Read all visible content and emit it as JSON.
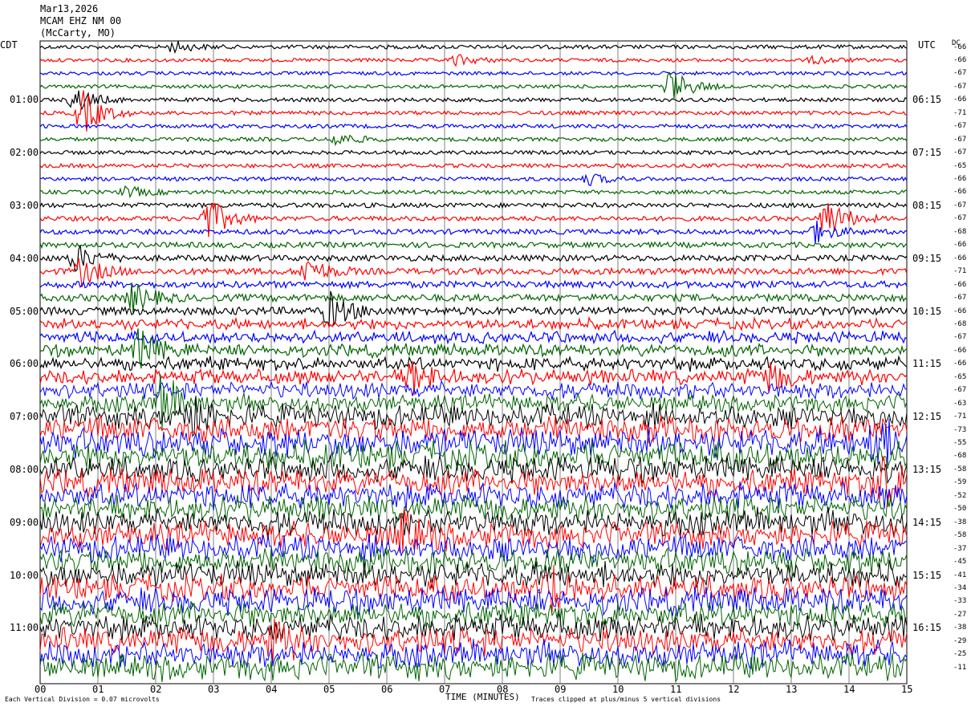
{
  "header": {
    "date": "Mar13,2026",
    "station": "MCAM EHZ NM 00",
    "location": "(McCarty, MO)"
  },
  "left_axis_label": "CDT",
  "right_axis_label": "UTC",
  "dc_label": "DC",
  "x_axis_title": "TIME (MINUTES)",
  "footer_left": "Each Vertical Division = 0.07 microvolts",
  "footer_right": "Traces clipped at plus/minus 5 vertical divisions",
  "colors": {
    "trace_cycle": [
      "#000000",
      "#ff0000",
      "#0000ff",
      "#006400"
    ],
    "grid": "#808080",
    "background": "#ffffff"
  },
  "chart_data": {
    "type": "line",
    "title": "MCAM EHZ NM 00 (McCarty, MO) Mar13,2026",
    "xlabel": "TIME (MINUTES)",
    "ylabel_left": "CDT",
    "ylabel_right": "UTC",
    "x_ticks": [
      "00",
      "01",
      "02",
      "03",
      "04",
      "05",
      "06",
      "07",
      "08",
      "09",
      "10",
      "11",
      "12",
      "13",
      "14",
      "15"
    ],
    "xlim": [
      0,
      15
    ],
    "trace_minutes": 15,
    "trace_count": 48,
    "left_time_labels": [
      "01:00",
      "02:00",
      "03:00",
      "04:00",
      "05:00",
      "06:00",
      "07:00",
      "08:00",
      "09:00",
      "10:00",
      "11:00"
    ],
    "right_time_labels": [
      "06:15",
      "07:15",
      "08:15",
      "09:15",
      "10:15",
      "11:15",
      "12:15",
      "13:15",
      "14:15",
      "15:15",
      "16:15"
    ],
    "hour_label_trace_index": [
      4,
      8,
      12,
      16,
      20,
      24,
      28,
      32,
      36,
      40,
      44
    ],
    "dc_offsets": [
      -66,
      -66,
      -67,
      -67,
      -66,
      -71,
      -67,
      -67,
      -67,
      -65,
      -66,
      -66,
      -67,
      -67,
      -68,
      -66,
      -66,
      -71,
      -66,
      -67,
      -66,
      -68,
      -67,
      -66,
      -66,
      -65,
      -67,
      -63,
      -71,
      -73,
      -55,
      -68,
      -58,
      -59,
      -52,
      -50,
      -38,
      -58,
      -37,
      -45,
      -41,
      -34,
      -33,
      -27,
      -38,
      -29,
      -25,
      -11
    ],
    "trace_activity": [
      1.0,
      0.9,
      0.9,
      0.9,
      1.0,
      1.0,
      1.0,
      1.0,
      1.0,
      1.0,
      1.0,
      1.0,
      1.2,
      1.2,
      1.3,
      1.4,
      1.5,
      1.6,
      1.7,
      1.8,
      2.0,
      2.1,
      2.3,
      2.4,
      2.6,
      2.8,
      3.2,
      3.4,
      4.5,
      5.0,
      5.5,
      5.5,
      5.0,
      5.0,
      5.0,
      5.0,
      5.0,
      5.0,
      5.0,
      5.0,
      5.0,
      5.0,
      5.0,
      5.0,
      5.0,
      5.0,
      5.0,
      5.0
    ],
    "events": [
      {
        "trace": 0,
        "minute": 2.3,
        "amplitude": 3
      },
      {
        "trace": 1,
        "minute": 7.2,
        "amplitude": 3
      },
      {
        "trace": 1,
        "minute": 13.4,
        "amplitude": 2
      },
      {
        "trace": 3,
        "minute": 10.9,
        "amplitude": 10
      },
      {
        "trace": 4,
        "minute": 0.6,
        "amplitude": 7
      },
      {
        "trace": 5,
        "minute": 0.7,
        "amplitude": 14
      },
      {
        "trace": 7,
        "minute": 5.1,
        "amplitude": 4
      },
      {
        "trace": 10,
        "minute": 9.5,
        "amplitude": 3
      },
      {
        "trace": 11,
        "minute": 1.5,
        "amplitude": 3
      },
      {
        "trace": 13,
        "minute": 2.9,
        "amplitude": 12
      },
      {
        "trace": 13,
        "minute": 13.6,
        "amplitude": 12
      },
      {
        "trace": 14,
        "minute": 13.4,
        "amplitude": 6
      },
      {
        "trace": 16,
        "minute": 0.6,
        "amplitude": 8
      },
      {
        "trace": 17,
        "minute": 0.7,
        "amplitude": 8
      },
      {
        "trace": 17,
        "minute": 4.6,
        "amplitude": 8
      },
      {
        "trace": 19,
        "minute": 1.6,
        "amplitude": 8
      },
      {
        "trace": 20,
        "minute": 5.0,
        "amplitude": 10
      },
      {
        "trace": 23,
        "minute": 1.7,
        "amplitude": 10
      },
      {
        "trace": 25,
        "minute": 6.4,
        "amplitude": 10
      },
      {
        "trace": 25,
        "minute": 12.6,
        "amplitude": 8
      },
      {
        "trace": 27,
        "minute": 2.1,
        "amplitude": 14
      },
      {
        "trace": 28,
        "minute": 2.5,
        "amplitude": 14
      },
      {
        "trace": 30,
        "minute": 14.4,
        "amplitude": 14
      },
      {
        "trace": 33,
        "minute": 14.5,
        "amplitude": 14
      },
      {
        "trace": 37,
        "minute": 6.2,
        "amplitude": 12
      },
      {
        "trace": 41,
        "minute": 8.8,
        "amplitude": 12
      },
      {
        "trace": 45,
        "minute": 4.0,
        "amplitude": 10
      }
    ]
  }
}
